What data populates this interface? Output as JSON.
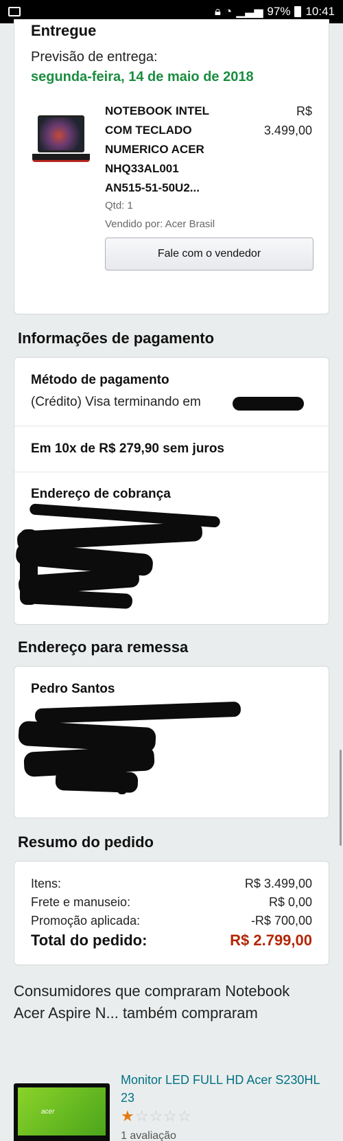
{
  "statusbar": {
    "battery": "97%",
    "time": "10:41"
  },
  "delivery": {
    "status": "Entregue",
    "forecast_label": "Previsão de entrega:",
    "forecast_date": "segunda-feira, 14 de maio de 2018"
  },
  "product": {
    "name_lines": [
      "NOTEBOOK INTEL",
      "COM TECLADO",
      "NUMERICO ACER",
      "NHQ33AL001",
      "AN515-51-50U2..."
    ],
    "price_currency": "R$",
    "price_value": "3.499,00",
    "qty": "Qtd: 1",
    "seller": "Vendido por: Acer Brasil",
    "contact_button": "Fale com o vendedor"
  },
  "payment": {
    "section_title": "Informações de pagamento",
    "method_label": "Método de pagamento",
    "method_value": "(Crédito) Visa terminando em",
    "installments": "Em 10x de R$ 279,90 sem juros",
    "billing_label": "Endereço de cobrança"
  },
  "shipping": {
    "section_title": "Endereço para remessa",
    "name": "Pedro Santos"
  },
  "summary": {
    "section_title": "Resumo do pedido",
    "items_label": "Itens:",
    "items_value": "R$ 3.499,00",
    "shipping_label": "Frete e manuseio:",
    "shipping_value": "R$ 0,00",
    "promo_label": "Promoção aplicada:",
    "promo_value": "-R$ 700,00",
    "total_label": "Total do pedido:",
    "total_value": "R$ 2.799,00"
  },
  "also_bought": {
    "title": "Consumidores que compraram Notebook Acer Aspire N... também compraram",
    "item_title": "Monitor LED FULL HD Acer S230HL 23",
    "item_logo": "acer",
    "rating": 1,
    "reviews": "1 avaliação"
  },
  "colors": {
    "accent_green": "#1a8d3f",
    "price_red": "#b12704",
    "link_teal": "#007185",
    "star": "#e47911"
  }
}
